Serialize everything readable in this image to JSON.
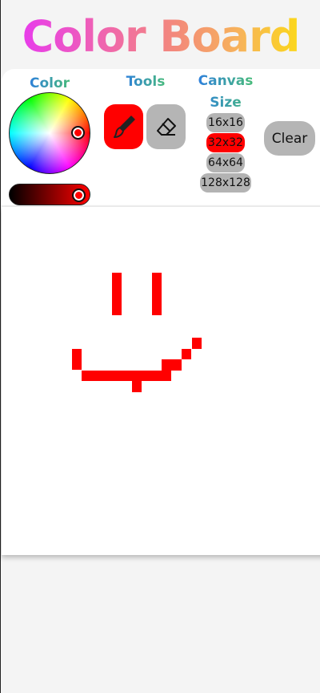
{
  "app": {
    "title": "Color Board"
  },
  "colors": {
    "selected": "#ff0000",
    "active_tool_bg": "#ff0000",
    "button_bg": "#b5b5b5",
    "pixel": "#ff0000"
  },
  "labels": {
    "color": "Color",
    "tools": "Tools",
    "canvas": "Canvas",
    "size": "Size"
  },
  "tools": {
    "brush": {
      "icon": "brush-icon",
      "active": true
    },
    "eraser": {
      "icon": "eraser-icon",
      "active": false
    }
  },
  "canvas_sizes": [
    {
      "label": "16x16",
      "active": false
    },
    {
      "label": "32x32",
      "active": true
    },
    {
      "label": "64x64",
      "active": false
    },
    {
      "label": "128x128",
      "active": false
    }
  ],
  "clear_label": "Clear",
  "brightness": 1.0
}
